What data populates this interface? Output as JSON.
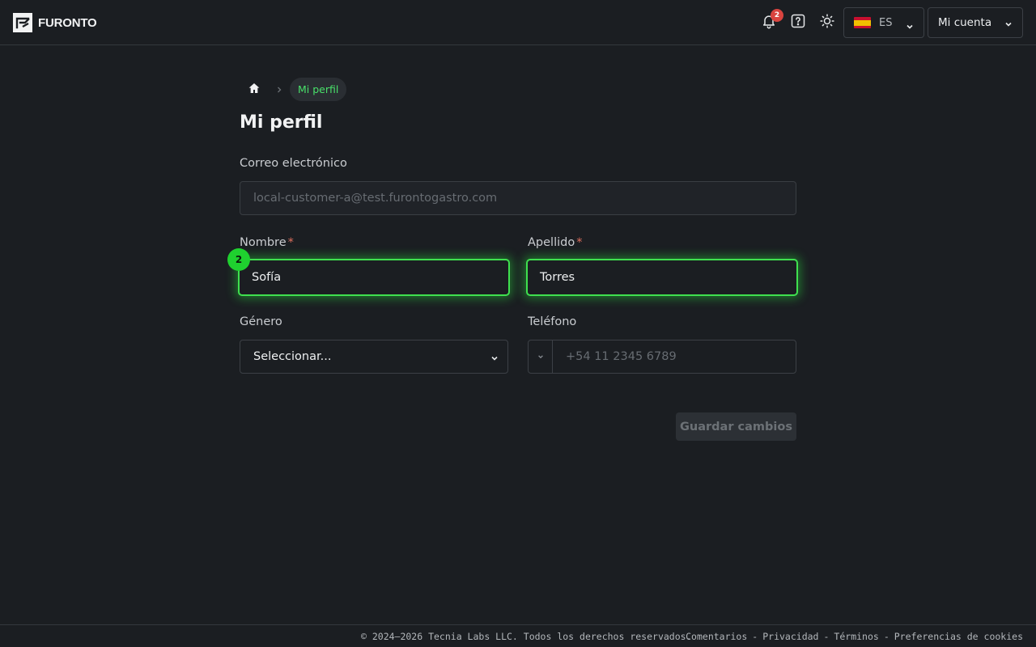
{
  "header": {
    "brand": "FURONTO",
    "notifications_count": "2",
    "language_code": "ES",
    "account_label": "Mi cuenta"
  },
  "breadcrumb": {
    "current": "Mi perfil"
  },
  "page": {
    "title": "Mi perfil"
  },
  "form": {
    "email_label": "Correo electrónico",
    "email_value": "local-customer-a@test.furontogastro.com",
    "first_name_label": "Nombre",
    "first_name_value": "Sofía",
    "last_name_label": "Apellido",
    "last_name_value": "Torres",
    "required_mark": "*",
    "step_badge": "2",
    "gender_label": "Género",
    "gender_value": "Seleccionar...",
    "phone_label": "Teléfono",
    "phone_placeholder": "+54 11 2345 6789",
    "save_label": "Guardar cambios"
  },
  "footer": {
    "copyright": "© 2024–2026 Tecnia Labs LLC. Todos los derechos reservados.",
    "links": [
      "Comentarios",
      "Privacidad",
      "Términos",
      "Preferencias de cookies"
    ],
    "separator": "-"
  },
  "colors": {
    "accent": "#3fe04f",
    "badge_red": "#d9443f",
    "background": "#1b1e22"
  },
  "icons": [
    "logo-icon",
    "bell-icon",
    "help-icon",
    "sun-icon",
    "flag-es-icon",
    "chevron-down-icon",
    "home-icon",
    "chevron-right-icon"
  ]
}
